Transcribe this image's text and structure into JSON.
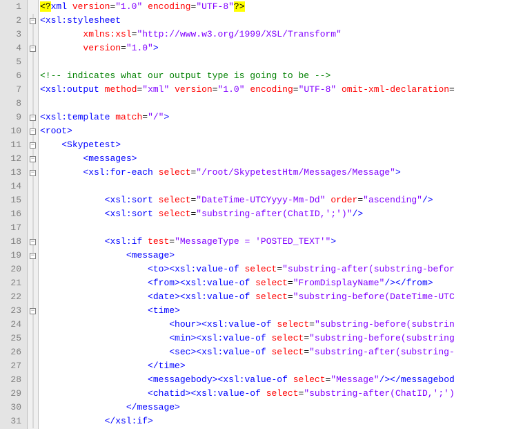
{
  "lines": [
    {
      "n": 1,
      "fold": null,
      "segs": [
        [
          "pi-hl",
          "<?"
        ],
        [
          "tag",
          "xml "
        ],
        [
          "attr-name",
          "version"
        ],
        [
          "txt",
          "="
        ],
        [
          "attr-val",
          "\"1.0\""
        ],
        [
          "txt",
          " "
        ],
        [
          "attr-name",
          "encoding"
        ],
        [
          "txt",
          "="
        ],
        [
          "attr-val",
          "\"UTF-8\""
        ],
        [
          "pi-hl",
          "?>"
        ]
      ]
    },
    {
      "n": 2,
      "fold": "box",
      "segs": [
        [
          "brkt",
          "<"
        ],
        [
          "tag",
          "xsl:stylesheet"
        ]
      ]
    },
    {
      "n": 3,
      "fold": "line",
      "segs": [
        [
          "txt",
          "        "
        ],
        [
          "attr-name",
          "xmlns:xsl"
        ],
        [
          "txt",
          "="
        ],
        [
          "attr-val",
          "\"http://www.w3.org/1999/XSL/Transform\""
        ]
      ]
    },
    {
      "n": 4,
      "fold": "box",
      "segs": [
        [
          "txt",
          "        "
        ],
        [
          "attr-name",
          "version"
        ],
        [
          "txt",
          "="
        ],
        [
          "attr-val",
          "\"1.0\""
        ],
        [
          "brkt",
          ">"
        ]
      ]
    },
    {
      "n": 5,
      "fold": "line",
      "segs": [
        [
          "txt",
          ""
        ]
      ]
    },
    {
      "n": 6,
      "fold": "line",
      "segs": [
        [
          "comment",
          "<!-- indicates what our output type is going to be -->"
        ]
      ]
    },
    {
      "n": 7,
      "fold": "line",
      "segs": [
        [
          "brkt",
          "<"
        ],
        [
          "tag",
          "xsl:output "
        ],
        [
          "attr-name",
          "method"
        ],
        [
          "txt",
          "="
        ],
        [
          "attr-val",
          "\"xml\""
        ],
        [
          "txt",
          " "
        ],
        [
          "attr-name",
          "version"
        ],
        [
          "txt",
          "="
        ],
        [
          "attr-val",
          "\"1.0\""
        ],
        [
          "txt",
          " "
        ],
        [
          "attr-name",
          "encoding"
        ],
        [
          "txt",
          "="
        ],
        [
          "attr-val",
          "\"UTF-8\""
        ],
        [
          "txt",
          " "
        ],
        [
          "attr-name",
          "omit-xml-declaration"
        ],
        [
          "txt",
          "="
        ]
      ]
    },
    {
      "n": 8,
      "fold": "line",
      "segs": [
        [
          "txt",
          ""
        ]
      ]
    },
    {
      "n": 9,
      "fold": "box",
      "segs": [
        [
          "brkt",
          "<"
        ],
        [
          "tag",
          "xsl:template "
        ],
        [
          "attr-name",
          "match"
        ],
        [
          "txt",
          "="
        ],
        [
          "attr-val",
          "\"/\""
        ],
        [
          "brkt",
          ">"
        ]
      ]
    },
    {
      "n": 10,
      "fold": "box",
      "segs": [
        [
          "brkt",
          "<"
        ],
        [
          "tag",
          "root"
        ],
        [
          "brkt",
          ">"
        ]
      ]
    },
    {
      "n": 11,
      "fold": "box",
      "segs": [
        [
          "txt",
          "    "
        ],
        [
          "brkt",
          "<"
        ],
        [
          "tag",
          "Skypetest"
        ],
        [
          "brkt",
          ">"
        ]
      ]
    },
    {
      "n": 12,
      "fold": "box",
      "segs": [
        [
          "txt",
          "        "
        ],
        [
          "brkt",
          "<"
        ],
        [
          "tag",
          "messages"
        ],
        [
          "brkt",
          ">"
        ]
      ]
    },
    {
      "n": 13,
      "fold": "box",
      "segs": [
        [
          "txt",
          "        "
        ],
        [
          "brkt",
          "<"
        ],
        [
          "tag",
          "xsl:for-each "
        ],
        [
          "attr-name",
          "select"
        ],
        [
          "txt",
          "="
        ],
        [
          "attr-val",
          "\"/root/SkypetestHtm/Messages/Message\""
        ],
        [
          "brkt",
          ">"
        ]
      ]
    },
    {
      "n": 14,
      "fold": "line",
      "segs": [
        [
          "txt",
          ""
        ]
      ]
    },
    {
      "n": 15,
      "fold": "line",
      "segs": [
        [
          "txt",
          "            "
        ],
        [
          "brkt",
          "<"
        ],
        [
          "tag",
          "xsl:sort "
        ],
        [
          "attr-name",
          "select"
        ],
        [
          "txt",
          "="
        ],
        [
          "attr-val",
          "\"DateTime-UTCYyyy-Mm-Dd\""
        ],
        [
          "txt",
          " "
        ],
        [
          "attr-name",
          "order"
        ],
        [
          "txt",
          "="
        ],
        [
          "attr-val",
          "\"ascending\""
        ],
        [
          "brkt",
          "/>"
        ]
      ]
    },
    {
      "n": 16,
      "fold": "line",
      "segs": [
        [
          "txt",
          "            "
        ],
        [
          "brkt",
          "<"
        ],
        [
          "tag",
          "xsl:sort "
        ],
        [
          "attr-name",
          "select"
        ],
        [
          "txt",
          "="
        ],
        [
          "attr-val",
          "\"substring-after(ChatID,';')\""
        ],
        [
          "brkt",
          "/>"
        ]
      ]
    },
    {
      "n": 17,
      "fold": "line",
      "segs": [
        [
          "txt",
          ""
        ]
      ]
    },
    {
      "n": 18,
      "fold": "box",
      "segs": [
        [
          "txt",
          "            "
        ],
        [
          "brkt",
          "<"
        ],
        [
          "tag",
          "xsl:if "
        ],
        [
          "attr-name",
          "test"
        ],
        [
          "txt",
          "="
        ],
        [
          "attr-val",
          "\"MessageType = 'POSTED_TEXT'\""
        ],
        [
          "brkt",
          ">"
        ]
      ]
    },
    {
      "n": 19,
      "fold": "box",
      "segs": [
        [
          "txt",
          "                "
        ],
        [
          "brkt",
          "<"
        ],
        [
          "tag",
          "message"
        ],
        [
          "brkt",
          ">"
        ]
      ]
    },
    {
      "n": 20,
      "fold": "line",
      "segs": [
        [
          "txt",
          "                    "
        ],
        [
          "brkt",
          "<"
        ],
        [
          "tag",
          "to"
        ],
        [
          "brkt",
          ">"
        ],
        [
          "brkt",
          "<"
        ],
        [
          "tag",
          "xsl:value-of "
        ],
        [
          "attr-name",
          "select"
        ],
        [
          "txt",
          "="
        ],
        [
          "attr-val",
          "\"substring-after(substring-befor"
        ]
      ]
    },
    {
      "n": 21,
      "fold": "line",
      "segs": [
        [
          "txt",
          "                    "
        ],
        [
          "brkt",
          "<"
        ],
        [
          "tag",
          "from"
        ],
        [
          "brkt",
          ">"
        ],
        [
          "brkt",
          "<"
        ],
        [
          "tag",
          "xsl:value-of "
        ],
        [
          "attr-name",
          "select"
        ],
        [
          "txt",
          "="
        ],
        [
          "attr-val",
          "\"FromDisplayName\""
        ],
        [
          "brkt",
          "/>"
        ],
        [
          "brkt",
          "</"
        ],
        [
          "tag",
          "from"
        ],
        [
          "brkt",
          ">"
        ]
      ]
    },
    {
      "n": 22,
      "fold": "line",
      "segs": [
        [
          "txt",
          "                    "
        ],
        [
          "brkt",
          "<"
        ],
        [
          "tag",
          "date"
        ],
        [
          "brkt",
          ">"
        ],
        [
          "brkt",
          "<"
        ],
        [
          "tag",
          "xsl:value-of "
        ],
        [
          "attr-name",
          "select"
        ],
        [
          "txt",
          "="
        ],
        [
          "attr-val",
          "\"substring-before(DateTime-UTC"
        ]
      ]
    },
    {
      "n": 23,
      "fold": "box",
      "segs": [
        [
          "txt",
          "                    "
        ],
        [
          "brkt",
          "<"
        ],
        [
          "tag",
          "time"
        ],
        [
          "brkt",
          ">"
        ]
      ]
    },
    {
      "n": 24,
      "fold": "line",
      "segs": [
        [
          "txt",
          "                        "
        ],
        [
          "brkt",
          "<"
        ],
        [
          "tag",
          "hour"
        ],
        [
          "brkt",
          ">"
        ],
        [
          "brkt",
          "<"
        ],
        [
          "tag",
          "xsl:value-of "
        ],
        [
          "attr-name",
          "select"
        ],
        [
          "txt",
          "="
        ],
        [
          "attr-val",
          "\"substring-before(substrin"
        ]
      ]
    },
    {
      "n": 25,
      "fold": "line",
      "segs": [
        [
          "txt",
          "                        "
        ],
        [
          "brkt",
          "<"
        ],
        [
          "tag",
          "min"
        ],
        [
          "brkt",
          ">"
        ],
        [
          "brkt",
          "<"
        ],
        [
          "tag",
          "xsl:value-of "
        ],
        [
          "attr-name",
          "select"
        ],
        [
          "txt",
          "="
        ],
        [
          "attr-val",
          "\"substring-before(substring"
        ]
      ]
    },
    {
      "n": 26,
      "fold": "line",
      "segs": [
        [
          "txt",
          "                        "
        ],
        [
          "brkt",
          "<"
        ],
        [
          "tag",
          "sec"
        ],
        [
          "brkt",
          ">"
        ],
        [
          "brkt",
          "<"
        ],
        [
          "tag",
          "xsl:value-of "
        ],
        [
          "attr-name",
          "select"
        ],
        [
          "txt",
          "="
        ],
        [
          "attr-val",
          "\"substring-after(substring-"
        ]
      ]
    },
    {
      "n": 27,
      "fold": "line",
      "segs": [
        [
          "txt",
          "                    "
        ],
        [
          "brkt",
          "</"
        ],
        [
          "tag",
          "time"
        ],
        [
          "brkt",
          ">"
        ]
      ]
    },
    {
      "n": 28,
      "fold": "line",
      "segs": [
        [
          "txt",
          "                    "
        ],
        [
          "brkt",
          "<"
        ],
        [
          "tag",
          "messagebody"
        ],
        [
          "brkt",
          ">"
        ],
        [
          "brkt",
          "<"
        ],
        [
          "tag",
          "xsl:value-of "
        ],
        [
          "attr-name",
          "select"
        ],
        [
          "txt",
          "="
        ],
        [
          "attr-val",
          "\"Message\""
        ],
        [
          "brkt",
          "/>"
        ],
        [
          "brkt",
          "</"
        ],
        [
          "tag",
          "messagebod"
        ]
      ]
    },
    {
      "n": 29,
      "fold": "line",
      "segs": [
        [
          "txt",
          "                    "
        ],
        [
          "brkt",
          "<"
        ],
        [
          "tag",
          "chatid"
        ],
        [
          "brkt",
          ">"
        ],
        [
          "brkt",
          "<"
        ],
        [
          "tag",
          "xsl:value-of "
        ],
        [
          "attr-name",
          "select"
        ],
        [
          "txt",
          "="
        ],
        [
          "attr-val",
          "\"substring-after(ChatID,';')"
        ]
      ]
    },
    {
      "n": 30,
      "fold": "line",
      "segs": [
        [
          "txt",
          "                "
        ],
        [
          "brkt",
          "</"
        ],
        [
          "tag",
          "message"
        ],
        [
          "brkt",
          ">"
        ]
      ]
    },
    {
      "n": 31,
      "fold": "line",
      "segs": [
        [
          "txt",
          "            "
        ],
        [
          "brkt",
          "</"
        ],
        [
          "tag",
          "xsl:if"
        ],
        [
          "brkt",
          ">"
        ]
      ]
    }
  ]
}
